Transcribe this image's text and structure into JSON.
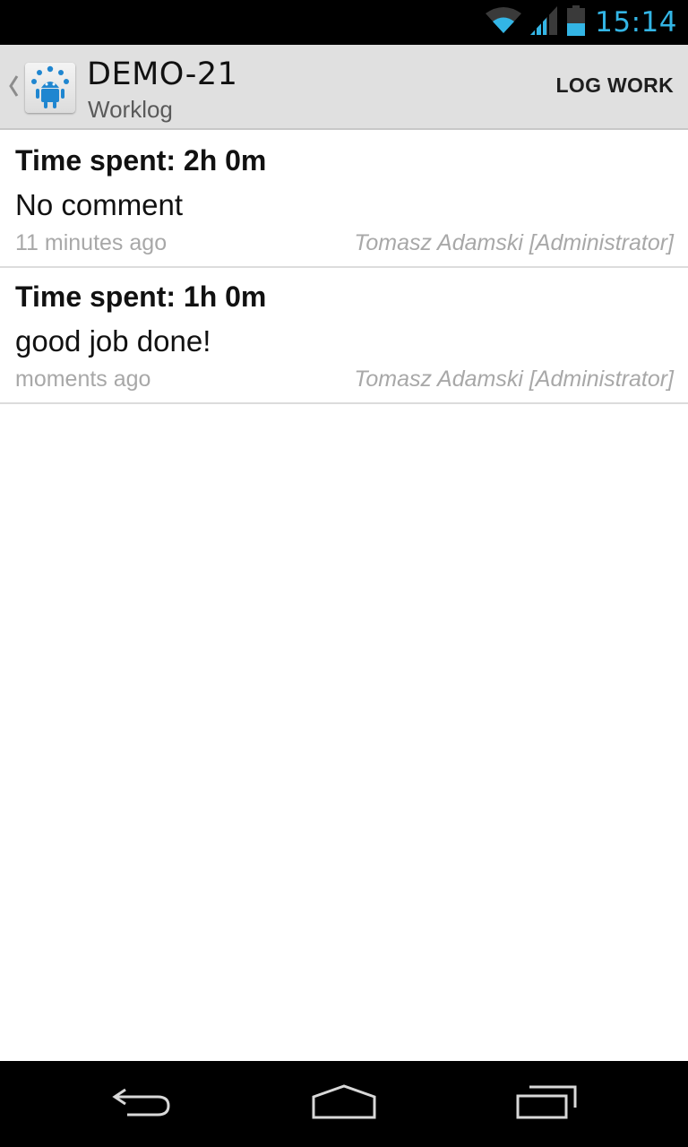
{
  "status_bar": {
    "time": "15:14",
    "icons": [
      "wifi-icon",
      "signal-icon",
      "battery-icon"
    ],
    "clock_color": "#33b5e5"
  },
  "action_bar": {
    "title": "DEMO-21",
    "subtitle": "Worklog",
    "action_label": "LOG WORK",
    "icons": [
      "up-caret-icon",
      "app-icon"
    ]
  },
  "worklogs": [
    {
      "time_spent": "Time spent: 2h 0m",
      "comment": "No comment",
      "ago": "11 minutes ago",
      "author": "Tomasz Adamski [Administrator]"
    },
    {
      "time_spent": "Time spent: 1h 0m",
      "comment": "good job done!",
      "ago": "moments ago",
      "author": "Tomasz Adamski [Administrator]"
    }
  ],
  "nav_bar": {
    "buttons": [
      "back-icon",
      "home-icon",
      "recent-apps-icon"
    ]
  }
}
